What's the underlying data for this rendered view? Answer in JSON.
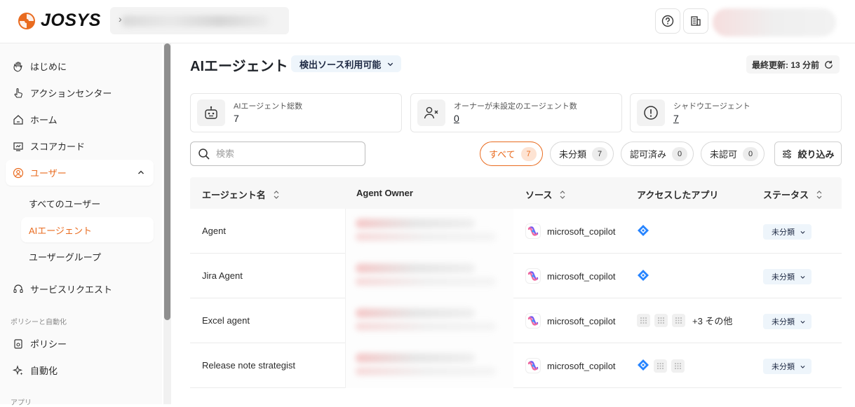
{
  "app": {
    "brand": "JOSYS",
    "accent": "#e96b1f"
  },
  "sidebar": {
    "items": [
      {
        "label": "はじめに",
        "icon": "hand-wave-icon"
      },
      {
        "label": "アクションセンター",
        "icon": "pointer-hand-icon"
      },
      {
        "label": "ホーム",
        "icon": "home-icon"
      },
      {
        "label": "スコアカード",
        "icon": "scorecard-icon"
      },
      {
        "label": "ユーザー",
        "icon": "user-circle-icon",
        "expanded": true
      }
    ],
    "user_children": [
      "すべてのユーザー",
      "AIエージェント",
      "ユーザーグループ"
    ],
    "service_request": "サービスリクエスト",
    "section_policy": "ポリシーと自動化",
    "policy": "ポリシー",
    "automation": "自動化",
    "section_apps": "アプリ"
  },
  "page": {
    "title": "AIエージェント",
    "source_filter": "検出ソース利用可能",
    "last_updated": "最終更新: 13 分前"
  },
  "cards": [
    {
      "label": "AIエージェント総数",
      "value": "7",
      "icon": "robot-icon"
    },
    {
      "label": "オーナーが未設定のエージェント数",
      "value": "0",
      "icon": "user-x-icon"
    },
    {
      "label": "シャドウエージェント",
      "value": "7",
      "icon": "alert-circle-icon"
    }
  ],
  "search": {
    "placeholder": "検索"
  },
  "chips": [
    {
      "label": "すべて",
      "count": "7",
      "active": true
    },
    {
      "label": "未分類",
      "count": "7"
    },
    {
      "label": "認可済み",
      "count": "0"
    },
    {
      "label": "未認可",
      "count": "0"
    }
  ],
  "filter_button": "絞り込み",
  "table": {
    "headers": [
      "エージェント名",
      "Agent Owner",
      "ソース",
      "アクセスしたアプリ",
      "ステータス"
    ],
    "rows": [
      {
        "name": "Agent",
        "source": "microsoft_copilot",
        "apps": [
          "jira"
        ],
        "more": "",
        "status": "未分類"
      },
      {
        "name": "Jira Agent",
        "source": "microsoft_copilot",
        "apps": [
          "jira"
        ],
        "more": "",
        "status": "未分類"
      },
      {
        "name": "Excel agent",
        "source": "microsoft_copilot",
        "apps": [
          "grid",
          "grid",
          "grid"
        ],
        "more": "+3 その他",
        "status": "未分類"
      },
      {
        "name": "Release note strategist",
        "source": "microsoft_copilot",
        "apps": [
          "jira",
          "grid",
          "grid"
        ],
        "more": "",
        "status": "未分類"
      }
    ]
  }
}
